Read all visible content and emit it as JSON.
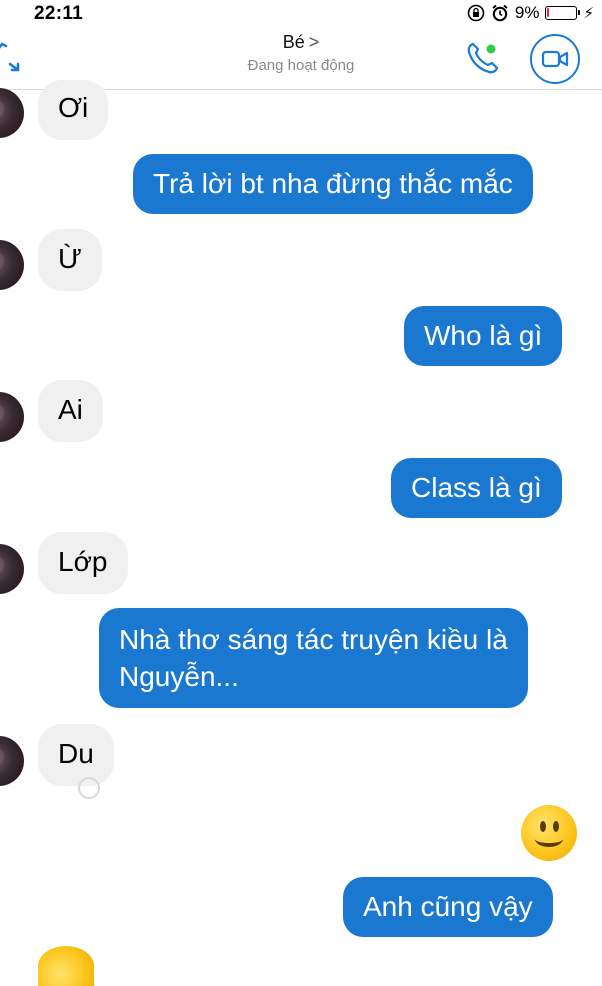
{
  "status_bar": {
    "time": "22:11",
    "battery_percent": "9%",
    "battery_level": 0.09,
    "icons": [
      "rotation-lock-icon",
      "alarm-icon",
      "battery-icon",
      "charging-icon"
    ]
  },
  "header": {
    "contact_name": "Bé",
    "contact_chevron": ">",
    "contact_status": "Đang hoạt động",
    "accent_color": "#1a7ad9",
    "online_dot_color": "#31cc46",
    "icons": [
      "back-icon",
      "phone-call-icon",
      "video-call-icon"
    ]
  },
  "messages": [
    {
      "side": "in",
      "text": "Ơi"
    },
    {
      "side": "out",
      "text": "Trả lời bt nha đừng thắc mắc"
    },
    {
      "side": "in",
      "text": "Ừ"
    },
    {
      "side": "out",
      "text": "Who là gì"
    },
    {
      "side": "in",
      "text": "Ai"
    },
    {
      "side": "out",
      "text": "Class là gì"
    },
    {
      "side": "in",
      "text": "Lớp"
    },
    {
      "side": "out",
      "lines": [
        "Nhà thơ sáng tác truyện kiều là",
        "Nguyễn..."
      ]
    },
    {
      "side": "in",
      "text": "Du"
    },
    {
      "side": "out",
      "emoji": "smiley-emoji"
    },
    {
      "side": "out",
      "text": "Anh cũng vậy"
    }
  ],
  "colors": {
    "outgoing_bubble": "#1b78d0",
    "incoming_bubble": "#f1f0f0"
  }
}
